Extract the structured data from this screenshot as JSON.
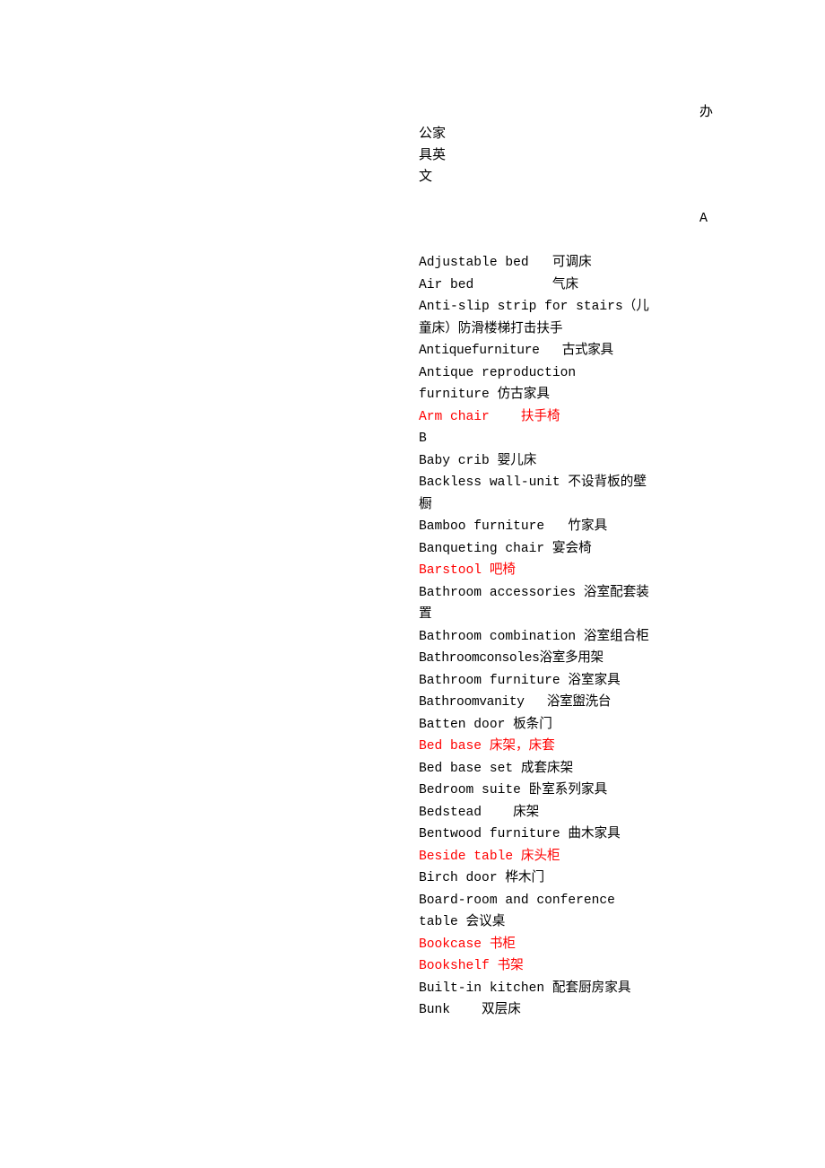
{
  "document": {
    "title_fragment_right": "办",
    "title_fragment_wrapped": "公家具英文",
    "full_title": "办公家具英文",
    "section_marker_a": "A",
    "text_color": "#000000",
    "highlight_color": "#ff0000",
    "background_color": "#ffffff"
  },
  "glossary": {
    "entries": [
      {
        "text": "Adjustable bed   可调床",
        "highlighted": false,
        "tight": false
      },
      {
        "text": "Air bed          气床",
        "highlighted": false,
        "tight": false
      },
      {
        "text": "Anti-slip strip for stairs（儿童床）防滑楼梯打击扶手",
        "highlighted": false,
        "tight": false
      },
      {
        "text": "Antiquefurniture   古式家具",
        "highlighted": false,
        "tight": true
      },
      {
        "text": "Antique reproduction furniture 仿古家具",
        "highlighted": false,
        "tight": false
      },
      {
        "text": "Arm chair    扶手椅",
        "highlighted": true,
        "tight": false
      },
      {
        "text": "B",
        "highlighted": false,
        "tight": false
      },
      {
        "text": "Baby crib 婴儿床",
        "highlighted": false,
        "tight": false
      },
      {
        "text": "Backless wall-unit 不设背板的壁橱",
        "highlighted": false,
        "tight": false
      },
      {
        "text": "Bamboo furniture   竹家具",
        "highlighted": false,
        "tight": false
      },
      {
        "text": "Banqueting chair 宴会椅",
        "highlighted": false,
        "tight": false
      },
      {
        "text": "Barstool 吧椅",
        "highlighted": true,
        "tight": false
      },
      {
        "text": "Bathroom accessories 浴室配套装置",
        "highlighted": false,
        "tight": false
      },
      {
        "text": "Bathroom combination 浴室组合柜",
        "highlighted": false,
        "tight": false
      },
      {
        "text": "Bathroomconsoles浴室多用架",
        "highlighted": false,
        "tight": true
      },
      {
        "text": "Bathroom furniture 浴室家具",
        "highlighted": false,
        "tight": false
      },
      {
        "text": "Bathroomvanity   浴室盥洗台",
        "highlighted": false,
        "tight": true
      },
      {
        "text": "Batten door 板条门",
        "highlighted": false,
        "tight": false
      },
      {
        "text": "Bed base 床架，床套",
        "highlighted": true,
        "tight": false
      },
      {
        "text": "Bed base set 成套床架",
        "highlighted": false,
        "tight": false
      },
      {
        "text": "Bedroom suite 卧室系列家具",
        "highlighted": false,
        "tight": false
      },
      {
        "text": "Bedstead    床架",
        "highlighted": false,
        "tight": false
      },
      {
        "text": "Bentwood furniture 曲木家具",
        "highlighted": false,
        "tight": false
      },
      {
        "text": "Beside table 床头柜",
        "highlighted": true,
        "tight": false
      },
      {
        "text": "Birch door 桦木门",
        "highlighted": false,
        "tight": false
      },
      {
        "text": "Board-room and conference table 会议桌",
        "highlighted": false,
        "tight": false
      },
      {
        "text": "Bookcase 书柜",
        "highlighted": true,
        "tight": false
      },
      {
        "text": "Bookshelf 书架",
        "highlighted": true,
        "tight": false
      },
      {
        "text": "Built-in kitchen 配套厨房家具",
        "highlighted": false,
        "tight": false
      },
      {
        "text": "Bunk    双层床",
        "highlighted": false,
        "tight": false
      }
    ]
  }
}
